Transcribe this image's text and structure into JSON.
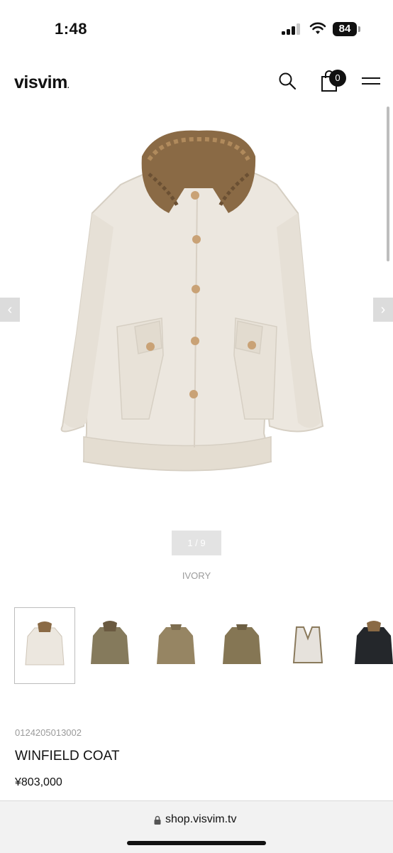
{
  "status_bar": {
    "time": "1:48",
    "battery": "84"
  },
  "header": {
    "logo": "visvim",
    "logo_mark": ".",
    "cart_count": "0",
    "icons": [
      "search-icon",
      "shopping-bag-icon",
      "hamburger-menu-icon"
    ]
  },
  "gallery": {
    "prev_icon": "chevron-left-icon",
    "next_icon": "chevron-right-icon",
    "counter": "1 / 9",
    "color": "IVORY",
    "thumbnails": [
      {
        "name": "ivory coat",
        "color": "#ece7df",
        "selected": true
      },
      {
        "name": "olive coat",
        "color": "#857a5c"
      },
      {
        "name": "khaki quilted coat",
        "color": "#968563"
      },
      {
        "name": "khaki coat",
        "color": "#857654"
      },
      {
        "name": "vest liner",
        "color": "#e6e2dc"
      },
      {
        "name": "black coat",
        "color": "#24272b"
      }
    ]
  },
  "product": {
    "sku": "0124205013002",
    "name": "WINFIELD COAT",
    "price": "¥803,000"
  },
  "browser": {
    "url": "shop.visvim.tv"
  },
  "colors": {
    "coat": "#ece7df",
    "fur": "#8a6a45",
    "button": "#c9a276",
    "counter_bg": "#e3e3e3",
    "muted_text": "#9a9a9a"
  }
}
